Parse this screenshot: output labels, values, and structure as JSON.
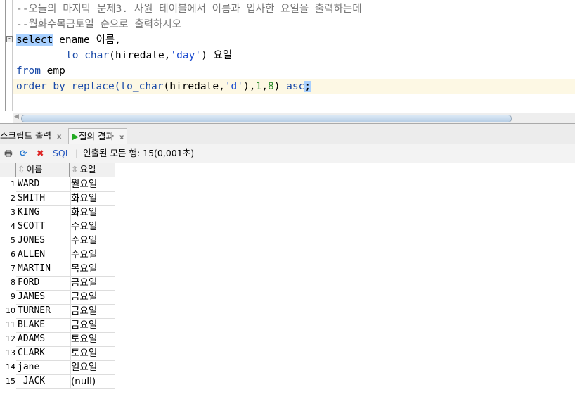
{
  "editor": {
    "comment1": "--오늘의 마지막 문제3. 사원 테이블에서 이름과 입사한 요일을 출력하는데",
    "comment2": "--월화수목금토일 순으로 출력하시오",
    "l3_kw": "select",
    "l3_rest": " ename 이름,",
    "l4_fn": "to_char",
    "l4_a": "(hiredate,",
    "l4_str": "'day'",
    "l4_b": ") 요일",
    "l5_kw": "from",
    "l5_rest": " emp",
    "l6_kw": "order by replace(to_char",
    "l6_a": "(hiredate,",
    "l6_str": "'d'",
    "l6_b": "),",
    "l6_n1": "1",
    "l6_c": ",",
    "l6_n2": "8",
    "l6_d": ") ",
    "l6_kw2": "asc",
    "l6_semi": ";"
  },
  "tabs": [
    {
      "label": "스크립트 출력",
      "close": "x"
    },
    {
      "label": "질의 결과",
      "close": "x"
    }
  ],
  "toolbar": {
    "sql": "SQL",
    "status": "인출된 모든 행: 15(0,001초)"
  },
  "columns": [
    "이름",
    "요일"
  ],
  "rows": [
    [
      "1",
      "WARD",
      "월요일"
    ],
    [
      "2",
      "SMITH",
      "화요일"
    ],
    [
      "3",
      "KING",
      "화요일"
    ],
    [
      "4",
      "SCOTT",
      "수요일"
    ],
    [
      "5",
      "JONES",
      "수요일"
    ],
    [
      "6",
      "ALLEN",
      "수요일"
    ],
    [
      "7",
      "MARTIN",
      "목요일"
    ],
    [
      "8",
      "FORD",
      "금요일"
    ],
    [
      "9",
      "JAMES",
      "금요일"
    ],
    [
      "10",
      "TURNER",
      "금요일"
    ],
    [
      "11",
      "BLAKE",
      "금요일"
    ],
    [
      "12",
      "ADAMS",
      "토요일"
    ],
    [
      "13",
      "CLARK",
      "토요일"
    ],
    [
      "14",
      "jane",
      "일요일"
    ],
    [
      "15",
      " JACK",
      "(null)"
    ]
  ]
}
